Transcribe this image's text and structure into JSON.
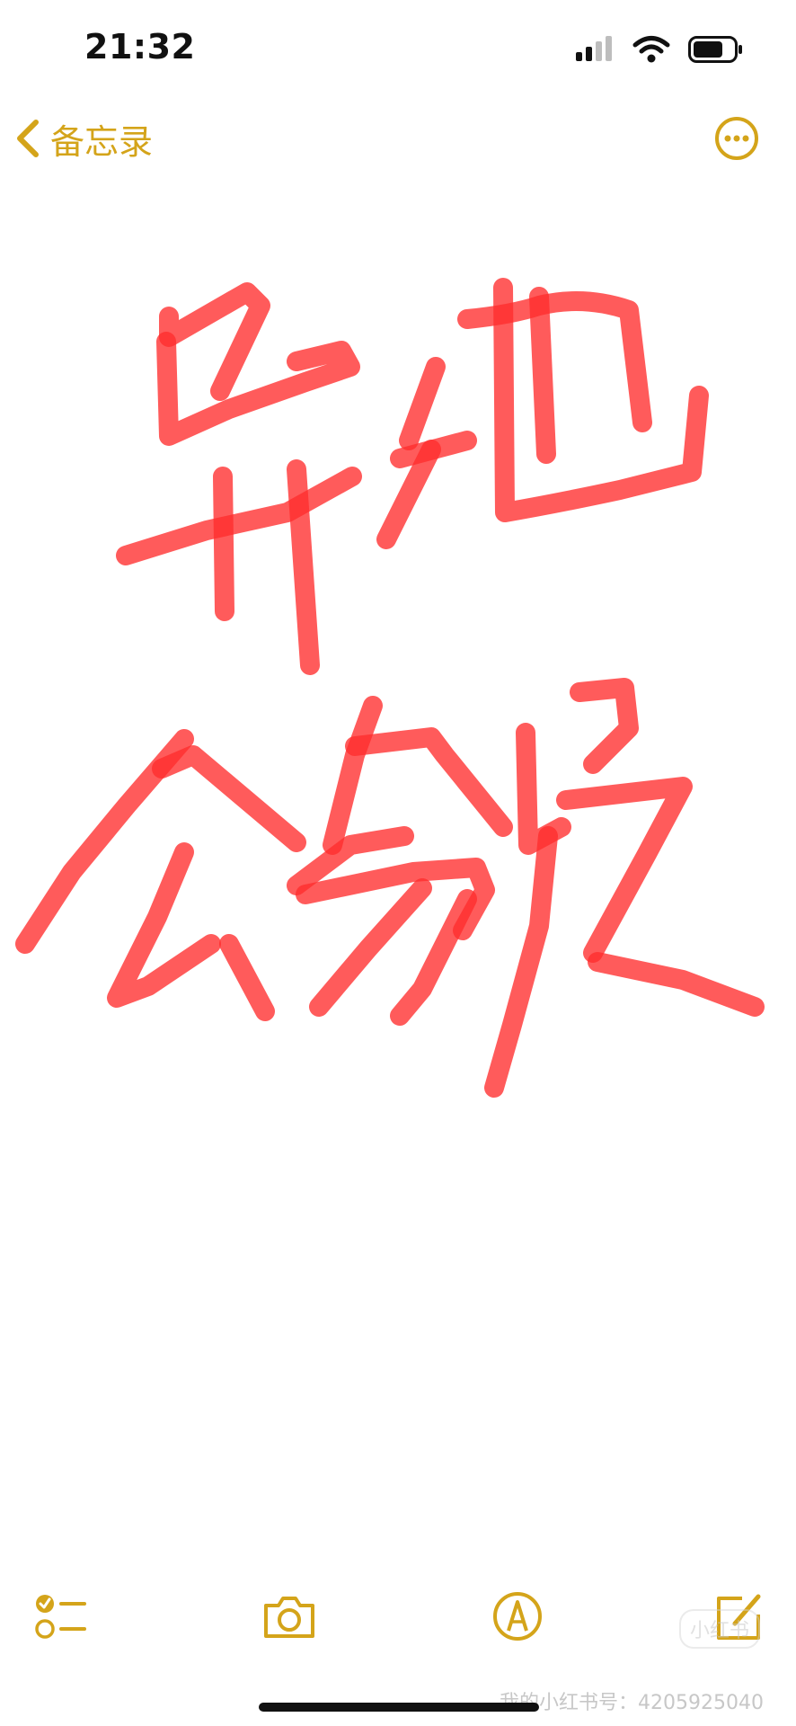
{
  "status_bar": {
    "time": "21:32"
  },
  "nav": {
    "back_label": "备忘录"
  },
  "note": {
    "handwritten_text": [
      "异地",
      "公务员"
    ],
    "ink_color": "#ff2d2d"
  },
  "accent_color": "#d4a41a",
  "toolbar": {
    "items": [
      "checklist-icon",
      "camera-icon",
      "markup-pen-icon",
      "compose-icon"
    ]
  },
  "watermark": {
    "logo": "小红书",
    "text": "我的小红书号：4205925040"
  }
}
